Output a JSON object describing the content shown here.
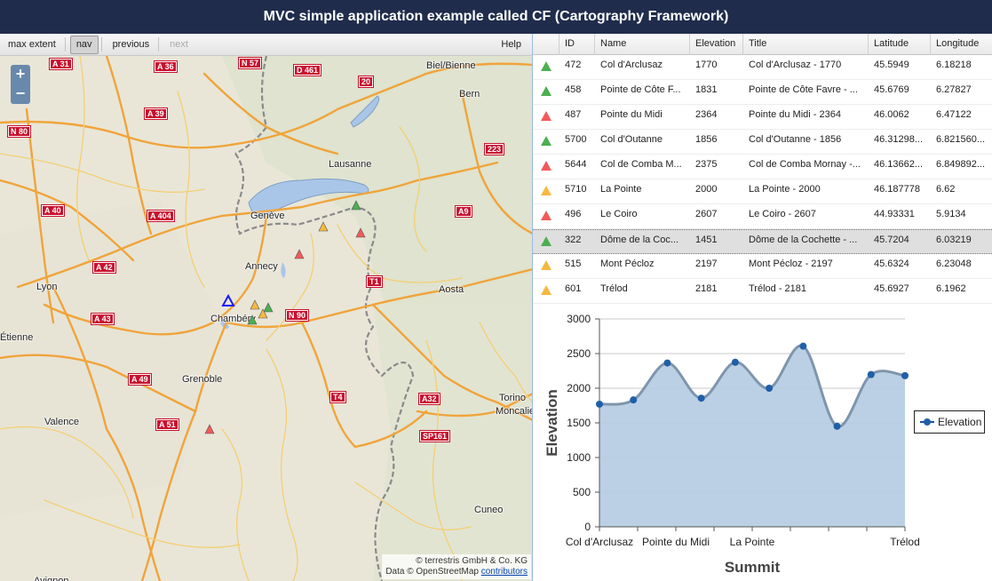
{
  "app": {
    "title": "MVC simple application example called CF (Cartography Framework)"
  },
  "toolbar": {
    "max_extent": "max extent",
    "nav": "nav",
    "previous": "previous",
    "next": "next",
    "help": "Help"
  },
  "map": {
    "zoom_in": "+",
    "zoom_out": "−",
    "attribution_line1": "© terrestris GmbH & Co. KG",
    "attribution_line2": "Data © OpenStreetMap",
    "attribution_link": "contributors",
    "cities": [
      "Biel/Bienne",
      "Bern",
      "Lausanne",
      "Genève",
      "Annecy",
      "Lyon",
      "Chambéry",
      "Aosta",
      "Grenoble",
      "Valence",
      "Torino",
      "Moncalieri",
      "Cuneo",
      "Avignon",
      "Étienne"
    ],
    "road_shields": [
      "A 31",
      "A 36",
      "N 57",
      "D 461",
      "20",
      "A 39",
      "N 80",
      "A 40",
      "A 404",
      "A 42",
      "A 43",
      "N 90",
      "T1",
      "A9",
      "223",
      "A 49",
      "A 51",
      "T4",
      "A32",
      "SP161"
    ]
  },
  "grid": {
    "columns": [
      "",
      "ID",
      "Name",
      "Elevation",
      "Title",
      "Latitude",
      "Longitude"
    ],
    "rows": [
      {
        "color": "#4caf50",
        "id": "472",
        "name": "Col d'Arclusaz",
        "elevation": "1770",
        "title": "Col d'Arclusaz - 1770",
        "latitude": "45.5949",
        "longitude": "6.18218"
      },
      {
        "color": "#4caf50",
        "id": "458",
        "name": "Pointe de Côte F...",
        "elevation": "1831",
        "title": "Pointe de Côte Favre - ...",
        "latitude": "45.6769",
        "longitude": "6.27827"
      },
      {
        "color": "#f25a5a",
        "id": "487",
        "name": "Pointe du Midi",
        "elevation": "2364",
        "title": "Pointe du Midi - 2364",
        "latitude": "46.0062",
        "longitude": "6.47122"
      },
      {
        "color": "#4caf50",
        "id": "5700",
        "name": "Col d'Outanne",
        "elevation": "1856",
        "title": "Col d'Outanne - 1856",
        "latitude": "46.31298...",
        "longitude": "6.821560..."
      },
      {
        "color": "#f25a5a",
        "id": "5644",
        "name": "Col de Comba M...",
        "elevation": "2375",
        "title": "Col de Comba Mornay -...",
        "latitude": "46.13662...",
        "longitude": "6.849892..."
      },
      {
        "color": "#f5b942",
        "id": "5710",
        "name": "La Pointe",
        "elevation": "2000",
        "title": "La Pointe - 2000",
        "latitude": "46.187778",
        "longitude": "6.62"
      },
      {
        "color": "#f25a5a",
        "id": "496",
        "name": "Le Coiro",
        "elevation": "2607",
        "title": "Le Coiro - 2607",
        "latitude": "44.93331",
        "longitude": "5.9134"
      },
      {
        "color": "#4caf50",
        "id": "322",
        "name": "Dôme de la Coc...",
        "elevation": "1451",
        "title": "Dôme de la Cochette - ...",
        "latitude": "45.7204",
        "longitude": "6.03219",
        "selected": true
      },
      {
        "color": "#f5b942",
        "id": "515",
        "name": "Mont Pécloz",
        "elevation": "2197",
        "title": "Mont Pécloz - 2197",
        "latitude": "45.6324",
        "longitude": "6.23048"
      },
      {
        "color": "#f5b942",
        "id": "601",
        "name": "Trélod",
        "elevation": "2181",
        "title": "Trélod - 2181",
        "latitude": "45.6927",
        "longitude": "6.1962"
      }
    ]
  },
  "chart_data": {
    "type": "area",
    "categories": [
      "Col d'Arclusaz",
      "Pointe de Côte Favre",
      "Pointe du Midi",
      "Col d'Outanne",
      "Col de Comba Mornay",
      "La Pointe",
      "Le Coiro",
      "Dôme de la Cochette",
      "Mont Pécloz",
      "Trélod"
    ],
    "tick_labels": [
      "Col d'Arclusaz",
      "",
      "Pointe du Midi",
      "",
      "La Pointe",
      "",
      "",
      "",
      "Trélod"
    ],
    "series": [
      {
        "name": "Elevation",
        "values": [
          1770,
          1831,
          2364,
          1856,
          2375,
          2000,
          2607,
          1451,
          2197,
          2181
        ]
      }
    ],
    "xlabel": "Summit",
    "ylabel": "Elevation",
    "ylim": [
      0,
      3000
    ],
    "yticks": [
      0,
      500,
      1000,
      1500,
      2000,
      2500,
      3000
    ],
    "grid": true,
    "legend": "right",
    "colors": {
      "fill": "#b7cde3",
      "line": "#7f95ad",
      "marker": "#1f5fa8"
    }
  }
}
